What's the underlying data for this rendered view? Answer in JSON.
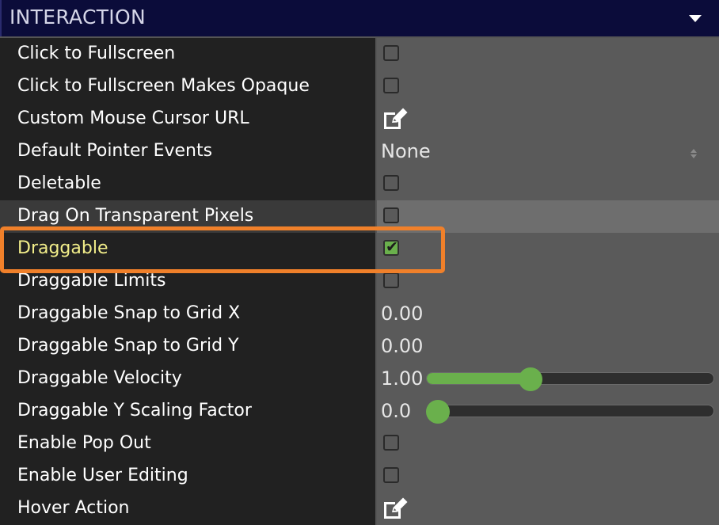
{
  "header": {
    "title": "INTERACTION"
  },
  "rows": [
    {
      "label": "Click to Fullscreen",
      "control": "checkbox",
      "checked": false
    },
    {
      "label": "Click to Fullscreen Makes Opaque",
      "control": "checkbox",
      "checked": false
    },
    {
      "label": "Custom Mouse Cursor URL",
      "control": "edit",
      "icon": "edit-icon"
    },
    {
      "label": "Default Pointer Events",
      "control": "select",
      "value": "None",
      "icon": "spinner-icon"
    },
    {
      "label": "Deletable",
      "control": "checkbox",
      "checked": false
    },
    {
      "label": "Drag On Transparent Pixels",
      "control": "checkbox",
      "checked": false,
      "state": "hover"
    },
    {
      "label": "Draggable",
      "control": "checkbox",
      "checked": true,
      "state": "selected",
      "highlighted": true
    },
    {
      "label": "Draggable Limits",
      "control": "checkbox",
      "checked": false
    },
    {
      "label": "Draggable Snap to Grid X",
      "control": "number",
      "value": "0.00"
    },
    {
      "label": "Draggable Snap to Grid Y",
      "control": "number",
      "value": "0.00"
    },
    {
      "label": "Draggable Velocity",
      "control": "slider",
      "value": "1.00",
      "fraction": 0.35
    },
    {
      "label": "Draggable Y Scaling Factor",
      "control": "slider",
      "value": "0.0",
      "fraction": 0.0
    },
    {
      "label": "Enable Pop Out",
      "control": "checkbox",
      "checked": false
    },
    {
      "label": "Enable User Editing",
      "control": "checkbox",
      "checked": false
    },
    {
      "label": "Hover Action",
      "control": "edit",
      "icon": "edit-icon"
    }
  ],
  "colors": {
    "header_bg": "#0b0c3a",
    "label_bg": "#212121",
    "value_bg": "#5a5a5a",
    "accent_green": "#6ab04c",
    "highlight_orange": "#f0802a",
    "selected_label": "#f2ee8a"
  }
}
